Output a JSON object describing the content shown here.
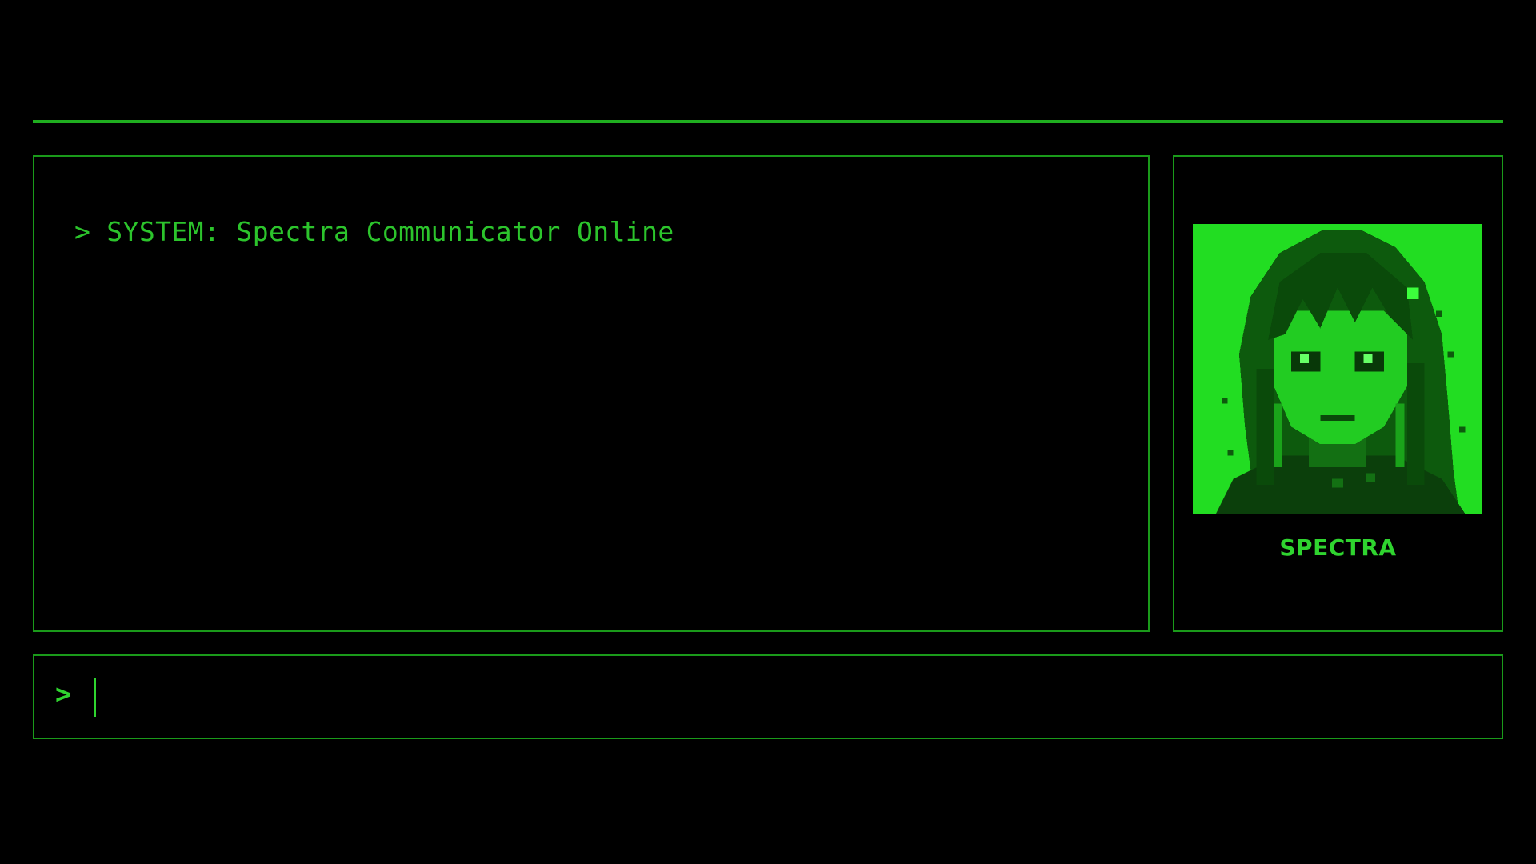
{
  "theme": {
    "background": "#000000",
    "accent": "#2fcf2f",
    "border": "#1a9a1a"
  },
  "chat_log": {
    "messages": [
      {
        "prompt": ">",
        "text": "SYSTEM: Spectra Communicator Online"
      }
    ]
  },
  "character": {
    "name": "SPECTRA",
    "portrait_icon": "pixel-portrait-icon"
  },
  "input": {
    "prompt": ">",
    "value": "",
    "placeholder": ""
  }
}
